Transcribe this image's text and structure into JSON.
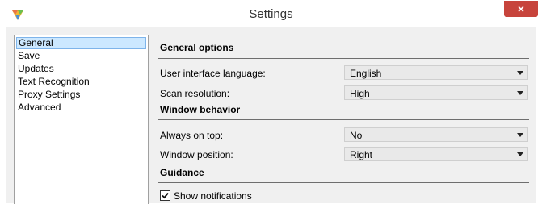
{
  "window": {
    "title": "Settings",
    "close_label": "×",
    "icon": "app-logo-icon"
  },
  "sidebar": {
    "items": [
      {
        "label": "General",
        "selected": true
      },
      {
        "label": "Save"
      },
      {
        "label": "Updates"
      },
      {
        "label": "Text Recognition"
      },
      {
        "label": "Proxy Settings"
      },
      {
        "label": "Advanced"
      }
    ]
  },
  "sections": {
    "general_options": {
      "title": "General options",
      "language_label": "User interface language:",
      "language_value": "English",
      "resolution_label": "Scan resolution:",
      "resolution_value": "High"
    },
    "window_behavior": {
      "title": "Window behavior",
      "on_top_label": "Always on top:",
      "on_top_value": "No",
      "position_label": "Window position:",
      "position_value": "Right"
    },
    "guidance": {
      "title": "Guidance",
      "notifications_label": "Show notifications",
      "notifications_checked": true
    }
  }
}
